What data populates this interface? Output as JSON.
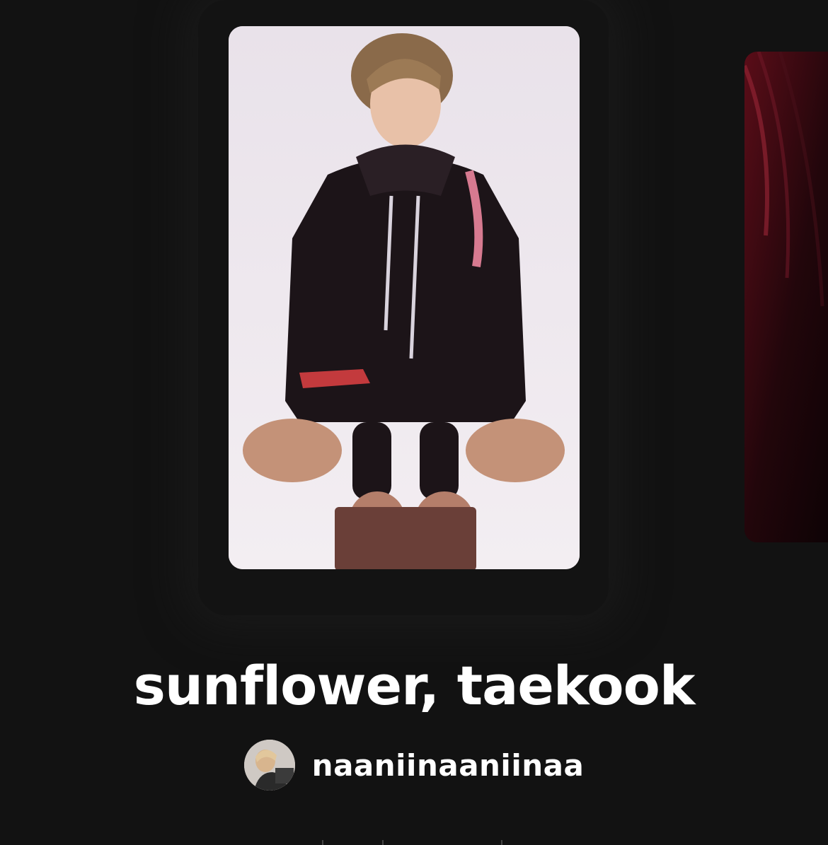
{
  "story": {
    "title": "sunflower, taekook",
    "author": "naaniinaaniinaa"
  },
  "colors": {
    "background": "#121212",
    "text": "#ffffff"
  },
  "icons": {
    "cover": "story-cover-image",
    "next_cover": "next-story-cover-image",
    "avatar": "author-avatar-image"
  }
}
